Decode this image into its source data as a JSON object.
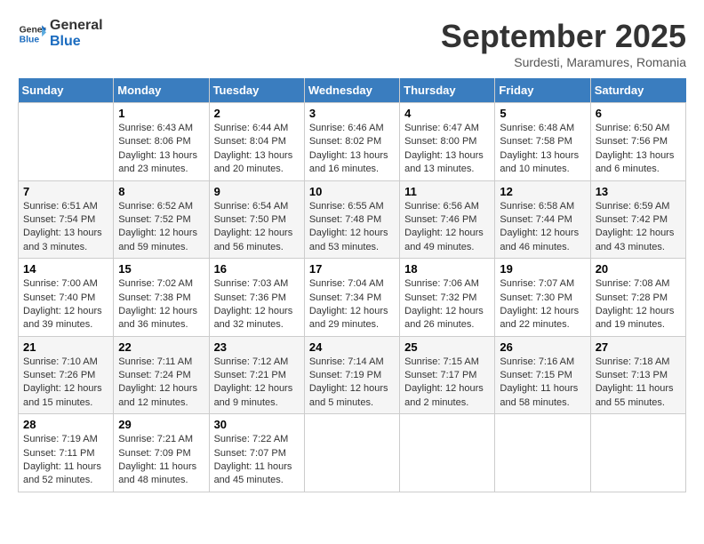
{
  "logo": {
    "line1": "General",
    "line2": "Blue"
  },
  "title": "September 2025",
  "subtitle": "Surdesti, Maramures, Romania",
  "days_of_week": [
    "Sunday",
    "Monday",
    "Tuesday",
    "Wednesday",
    "Thursday",
    "Friday",
    "Saturday"
  ],
  "weeks": [
    [
      null,
      {
        "day": "1",
        "sunrise": "6:43 AM",
        "sunset": "8:06 PM",
        "daylight": "13 hours and 23 minutes."
      },
      {
        "day": "2",
        "sunrise": "6:44 AM",
        "sunset": "8:04 PM",
        "daylight": "13 hours and 20 minutes."
      },
      {
        "day": "3",
        "sunrise": "6:46 AM",
        "sunset": "8:02 PM",
        "daylight": "13 hours and 16 minutes."
      },
      {
        "day": "4",
        "sunrise": "6:47 AM",
        "sunset": "8:00 PM",
        "daylight": "13 hours and 13 minutes."
      },
      {
        "day": "5",
        "sunrise": "6:48 AM",
        "sunset": "7:58 PM",
        "daylight": "13 hours and 10 minutes."
      },
      {
        "day": "6",
        "sunrise": "6:50 AM",
        "sunset": "7:56 PM",
        "daylight": "13 hours and 6 minutes."
      }
    ],
    [
      {
        "day": "7",
        "sunrise": "6:51 AM",
        "sunset": "7:54 PM",
        "daylight": "13 hours and 3 minutes."
      },
      {
        "day": "8",
        "sunrise": "6:52 AM",
        "sunset": "7:52 PM",
        "daylight": "12 hours and 59 minutes."
      },
      {
        "day": "9",
        "sunrise": "6:54 AM",
        "sunset": "7:50 PM",
        "daylight": "12 hours and 56 minutes."
      },
      {
        "day": "10",
        "sunrise": "6:55 AM",
        "sunset": "7:48 PM",
        "daylight": "12 hours and 53 minutes."
      },
      {
        "day": "11",
        "sunrise": "6:56 AM",
        "sunset": "7:46 PM",
        "daylight": "12 hours and 49 minutes."
      },
      {
        "day": "12",
        "sunrise": "6:58 AM",
        "sunset": "7:44 PM",
        "daylight": "12 hours and 46 minutes."
      },
      {
        "day": "13",
        "sunrise": "6:59 AM",
        "sunset": "7:42 PM",
        "daylight": "12 hours and 43 minutes."
      }
    ],
    [
      {
        "day": "14",
        "sunrise": "7:00 AM",
        "sunset": "7:40 PM",
        "daylight": "12 hours and 39 minutes."
      },
      {
        "day": "15",
        "sunrise": "7:02 AM",
        "sunset": "7:38 PM",
        "daylight": "12 hours and 36 minutes."
      },
      {
        "day": "16",
        "sunrise": "7:03 AM",
        "sunset": "7:36 PM",
        "daylight": "12 hours and 32 minutes."
      },
      {
        "day": "17",
        "sunrise": "7:04 AM",
        "sunset": "7:34 PM",
        "daylight": "12 hours and 29 minutes."
      },
      {
        "day": "18",
        "sunrise": "7:06 AM",
        "sunset": "7:32 PM",
        "daylight": "12 hours and 26 minutes."
      },
      {
        "day": "19",
        "sunrise": "7:07 AM",
        "sunset": "7:30 PM",
        "daylight": "12 hours and 22 minutes."
      },
      {
        "day": "20",
        "sunrise": "7:08 AM",
        "sunset": "7:28 PM",
        "daylight": "12 hours and 19 minutes."
      }
    ],
    [
      {
        "day": "21",
        "sunrise": "7:10 AM",
        "sunset": "7:26 PM",
        "daylight": "12 hours and 15 minutes."
      },
      {
        "day": "22",
        "sunrise": "7:11 AM",
        "sunset": "7:24 PM",
        "daylight": "12 hours and 12 minutes."
      },
      {
        "day": "23",
        "sunrise": "7:12 AM",
        "sunset": "7:21 PM",
        "daylight": "12 hours and 9 minutes."
      },
      {
        "day": "24",
        "sunrise": "7:14 AM",
        "sunset": "7:19 PM",
        "daylight": "12 hours and 5 minutes."
      },
      {
        "day": "25",
        "sunrise": "7:15 AM",
        "sunset": "7:17 PM",
        "daylight": "12 hours and 2 minutes."
      },
      {
        "day": "26",
        "sunrise": "7:16 AM",
        "sunset": "7:15 PM",
        "daylight": "11 hours and 58 minutes."
      },
      {
        "day": "27",
        "sunrise": "7:18 AM",
        "sunset": "7:13 PM",
        "daylight": "11 hours and 55 minutes."
      }
    ],
    [
      {
        "day": "28",
        "sunrise": "7:19 AM",
        "sunset": "7:11 PM",
        "daylight": "11 hours and 52 minutes."
      },
      {
        "day": "29",
        "sunrise": "7:21 AM",
        "sunset": "7:09 PM",
        "daylight": "11 hours and 48 minutes."
      },
      {
        "day": "30",
        "sunrise": "7:22 AM",
        "sunset": "7:07 PM",
        "daylight": "11 hours and 45 minutes."
      },
      null,
      null,
      null,
      null
    ]
  ],
  "labels": {
    "sunrise": "Sunrise:",
    "sunset": "Sunset:",
    "daylight": "Daylight:"
  }
}
